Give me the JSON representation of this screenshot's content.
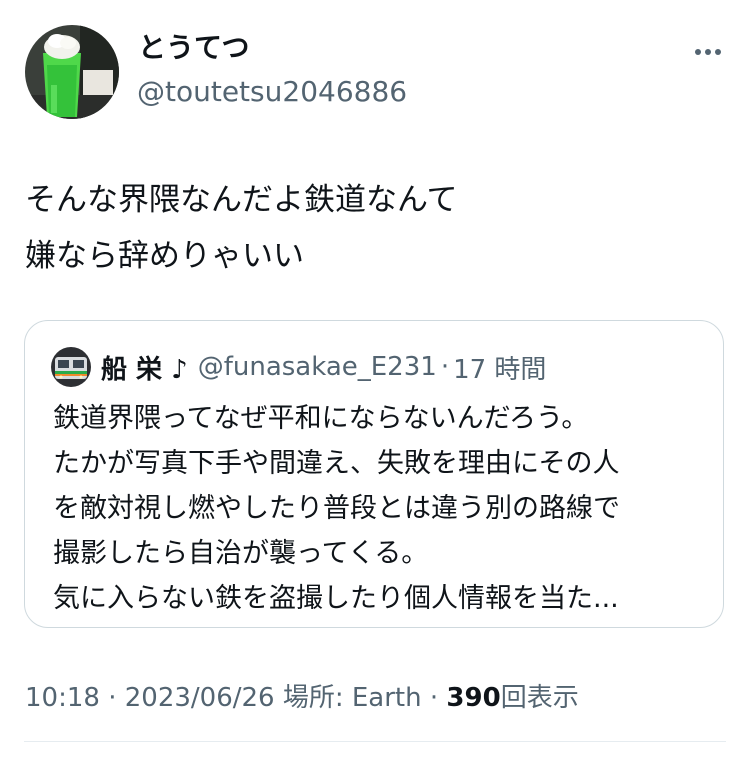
{
  "author": {
    "display_name": "とうてつ",
    "handle": "@toutetsu2046886"
  },
  "tweet": {
    "lines": [
      "そんな界隈なんだよ鉄道なんて",
      "嫌なら辞めりゃいい"
    ]
  },
  "quote": {
    "display_name": "船 栄 ♪",
    "handle": "@funasakae_E231",
    "separator": "·",
    "time": "17 時間",
    "lines": [
      "鉄道界隈ってなぜ平和にならないんだろう。",
      "たかが写真下手や間違え、失敗を理由にその人",
      "を敵対視し燃やしたり普段とは違う別の路線で",
      "撮影したら自治が襲ってくる。",
      "気に入らない鉄を盗撮したり個人情報を当た..."
    ]
  },
  "meta": {
    "time": "10:18",
    "sep1": "·",
    "date": "2023/06/26",
    "location_label": "場所: Earth",
    "sep2": "·",
    "views_count": "390",
    "views_label": "回表示"
  },
  "icons": {
    "more": "more-horizontal-icon",
    "avatar": "melon-soda-photo",
    "quote_avatar": "train-photo"
  },
  "colors": {
    "text": "#0f1419",
    "secondary": "#536471",
    "border": "#cfd9de"
  }
}
